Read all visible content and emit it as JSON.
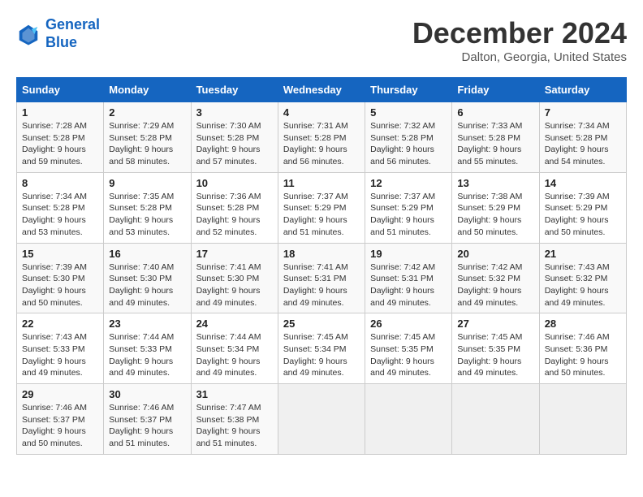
{
  "header": {
    "logo_line1": "General",
    "logo_line2": "Blue",
    "month": "December 2024",
    "location": "Dalton, Georgia, United States"
  },
  "days_of_week": [
    "Sunday",
    "Monday",
    "Tuesday",
    "Wednesday",
    "Thursday",
    "Friday",
    "Saturday"
  ],
  "weeks": [
    [
      {
        "day": "1",
        "sunrise": "7:28 AM",
        "sunset": "5:28 PM",
        "daylight": "9 hours and 59 minutes."
      },
      {
        "day": "2",
        "sunrise": "7:29 AM",
        "sunset": "5:28 PM",
        "daylight": "9 hours and 58 minutes."
      },
      {
        "day": "3",
        "sunrise": "7:30 AM",
        "sunset": "5:28 PM",
        "daylight": "9 hours and 57 minutes."
      },
      {
        "day": "4",
        "sunrise": "7:31 AM",
        "sunset": "5:28 PM",
        "daylight": "9 hours and 56 minutes."
      },
      {
        "day": "5",
        "sunrise": "7:32 AM",
        "sunset": "5:28 PM",
        "daylight": "9 hours and 56 minutes."
      },
      {
        "day": "6",
        "sunrise": "7:33 AM",
        "sunset": "5:28 PM",
        "daylight": "9 hours and 55 minutes."
      },
      {
        "day": "7",
        "sunrise": "7:34 AM",
        "sunset": "5:28 PM",
        "daylight": "9 hours and 54 minutes."
      }
    ],
    [
      {
        "day": "8",
        "sunrise": "7:34 AM",
        "sunset": "5:28 PM",
        "daylight": "9 hours and 53 minutes."
      },
      {
        "day": "9",
        "sunrise": "7:35 AM",
        "sunset": "5:28 PM",
        "daylight": "9 hours and 53 minutes."
      },
      {
        "day": "10",
        "sunrise": "7:36 AM",
        "sunset": "5:28 PM",
        "daylight": "9 hours and 52 minutes."
      },
      {
        "day": "11",
        "sunrise": "7:37 AM",
        "sunset": "5:29 PM",
        "daylight": "9 hours and 51 minutes."
      },
      {
        "day": "12",
        "sunrise": "7:37 AM",
        "sunset": "5:29 PM",
        "daylight": "9 hours and 51 minutes."
      },
      {
        "day": "13",
        "sunrise": "7:38 AM",
        "sunset": "5:29 PM",
        "daylight": "9 hours and 50 minutes."
      },
      {
        "day": "14",
        "sunrise": "7:39 AM",
        "sunset": "5:29 PM",
        "daylight": "9 hours and 50 minutes."
      }
    ],
    [
      {
        "day": "15",
        "sunrise": "7:39 AM",
        "sunset": "5:30 PM",
        "daylight": "9 hours and 50 minutes."
      },
      {
        "day": "16",
        "sunrise": "7:40 AM",
        "sunset": "5:30 PM",
        "daylight": "9 hours and 49 minutes."
      },
      {
        "day": "17",
        "sunrise": "7:41 AM",
        "sunset": "5:30 PM",
        "daylight": "9 hours and 49 minutes."
      },
      {
        "day": "18",
        "sunrise": "7:41 AM",
        "sunset": "5:31 PM",
        "daylight": "9 hours and 49 minutes."
      },
      {
        "day": "19",
        "sunrise": "7:42 AM",
        "sunset": "5:31 PM",
        "daylight": "9 hours and 49 minutes."
      },
      {
        "day": "20",
        "sunrise": "7:42 AM",
        "sunset": "5:32 PM",
        "daylight": "9 hours and 49 minutes."
      },
      {
        "day": "21",
        "sunrise": "7:43 AM",
        "sunset": "5:32 PM",
        "daylight": "9 hours and 49 minutes."
      }
    ],
    [
      {
        "day": "22",
        "sunrise": "7:43 AM",
        "sunset": "5:33 PM",
        "daylight": "9 hours and 49 minutes."
      },
      {
        "day": "23",
        "sunrise": "7:44 AM",
        "sunset": "5:33 PM",
        "daylight": "9 hours and 49 minutes."
      },
      {
        "day": "24",
        "sunrise": "7:44 AM",
        "sunset": "5:34 PM",
        "daylight": "9 hours and 49 minutes."
      },
      {
        "day": "25",
        "sunrise": "7:45 AM",
        "sunset": "5:34 PM",
        "daylight": "9 hours and 49 minutes."
      },
      {
        "day": "26",
        "sunrise": "7:45 AM",
        "sunset": "5:35 PM",
        "daylight": "9 hours and 49 minutes."
      },
      {
        "day": "27",
        "sunrise": "7:45 AM",
        "sunset": "5:35 PM",
        "daylight": "9 hours and 49 minutes."
      },
      {
        "day": "28",
        "sunrise": "7:46 AM",
        "sunset": "5:36 PM",
        "daylight": "9 hours and 50 minutes."
      }
    ],
    [
      {
        "day": "29",
        "sunrise": "7:46 AM",
        "sunset": "5:37 PM",
        "daylight": "9 hours and 50 minutes."
      },
      {
        "day": "30",
        "sunrise": "7:46 AM",
        "sunset": "5:37 PM",
        "daylight": "9 hours and 51 minutes."
      },
      {
        "day": "31",
        "sunrise": "7:47 AM",
        "sunset": "5:38 PM",
        "daylight": "9 hours and 51 minutes."
      },
      null,
      null,
      null,
      null
    ]
  ]
}
